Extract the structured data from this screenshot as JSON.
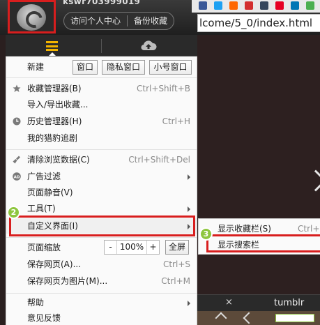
{
  "header": {
    "username": "kswr703999019",
    "buttons": [
      "访问个人中心",
      "备份收藏"
    ]
  },
  "address_bar": {
    "url": "lcome/5_0/index.html"
  },
  "menu": {
    "new_label": "新建",
    "window_buttons": [
      "窗口",
      "隐私窗口",
      "小号窗口"
    ],
    "items": [
      {
        "label": "收藏管理器(B)",
        "shortcut": "Ctrl+Shift+B",
        "icon": "star-icon"
      },
      {
        "label": "导入/导出收藏...",
        "shortcut": ""
      },
      {
        "label": "历史管理器(H)",
        "shortcut": "Ctrl+H",
        "icon": "clock-icon"
      },
      {
        "label": "我的猎豹追剧",
        "shortcut": ""
      },
      {
        "label": "清除浏览数据(C)",
        "shortcut": "Ctrl+Shift+Del",
        "icon": "broom-icon"
      },
      {
        "label": "广告过滤",
        "shortcut": "",
        "icon": "ad-block-icon"
      },
      {
        "label": "页面静音(V)",
        "shortcut": ""
      },
      {
        "label": "工具(T)",
        "shortcut": ""
      },
      {
        "label": "自定义界面(I)",
        "shortcut": ""
      },
      {
        "label": "页面缩放",
        "shortcut": ""
      },
      {
        "label": "保存网页(A)...",
        "shortcut": "Ctrl+S"
      },
      {
        "label": "保存网页为图片(M)...",
        "shortcut": "Ctrl+M"
      },
      {
        "label": "帮助",
        "shortcut": ""
      },
      {
        "label": "意见反馈",
        "shortcut": ""
      }
    ],
    "zoom": {
      "minus": "-",
      "value": "100%",
      "plus": "+",
      "full": "全屏"
    }
  },
  "submenu": {
    "items": [
      {
        "label": "显示收藏栏(S)",
        "shortcut": "Ctrl+"
      },
      {
        "label": "显示搜索栏",
        "shortcut": ""
      }
    ]
  },
  "badges": [
    "2",
    "3"
  ],
  "bottom_tabs": {
    "close": "×",
    "tab_label": "tumblr"
  },
  "colors": {
    "highlight": "#d81e1e",
    "badge": "#8ec63f",
    "menu_icon": "#f3b400"
  }
}
